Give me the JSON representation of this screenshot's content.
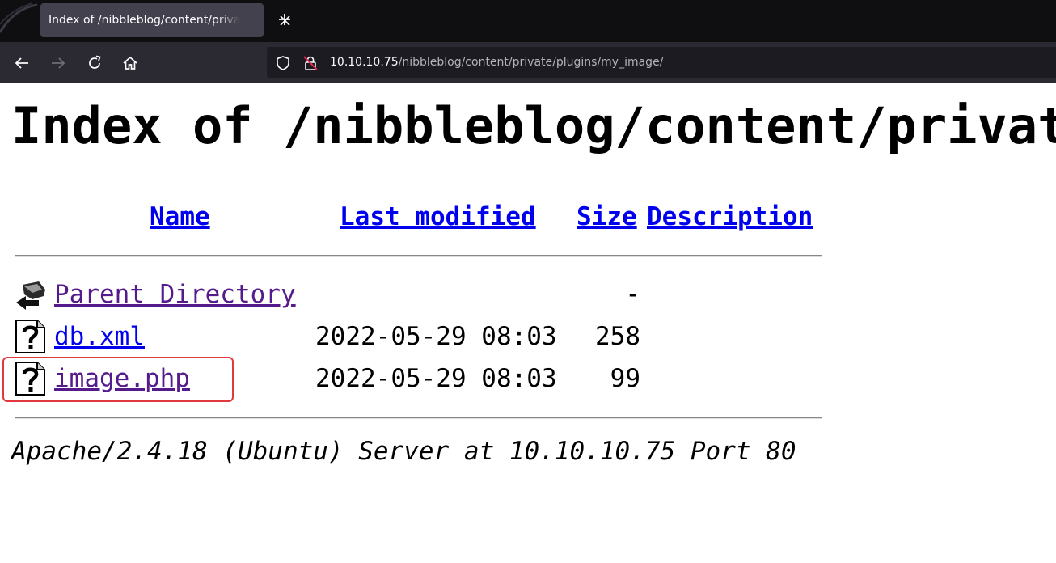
{
  "browser": {
    "tab": {
      "title": "Index of /nibbleblog/content/private/plugins/my_image/"
    },
    "url": {
      "host": "10.10.10.75",
      "path": "/nibbleblog/content/private/plugins/my_image/"
    }
  },
  "page": {
    "heading": "Index of /nibbleblog/content/private/plugins/my_image",
    "columns": {
      "name": "Name",
      "last_modified": "Last modified",
      "size": "Size",
      "description": "Description"
    },
    "rows": [
      {
        "name": "Parent Directory",
        "date": "",
        "size": "-",
        "icon": "back-icon",
        "visited": true
      },
      {
        "name": "db.xml",
        "date": "2022-05-29 08:03",
        "size": "258",
        "icon": "unknown-file-icon",
        "visited": false
      },
      {
        "name": "image.php",
        "date": "2022-05-29 08:03",
        "size": "99",
        "icon": "unknown-file-icon",
        "visited": true,
        "highlighted": true
      }
    ],
    "footer": "Apache/2.4.18 (Ubuntu) Server at 10.10.10.75 Port 80"
  },
  "colors": {
    "link": "#0000ee",
    "visited": "#551a8b",
    "highlight_border": "#e0393e"
  }
}
